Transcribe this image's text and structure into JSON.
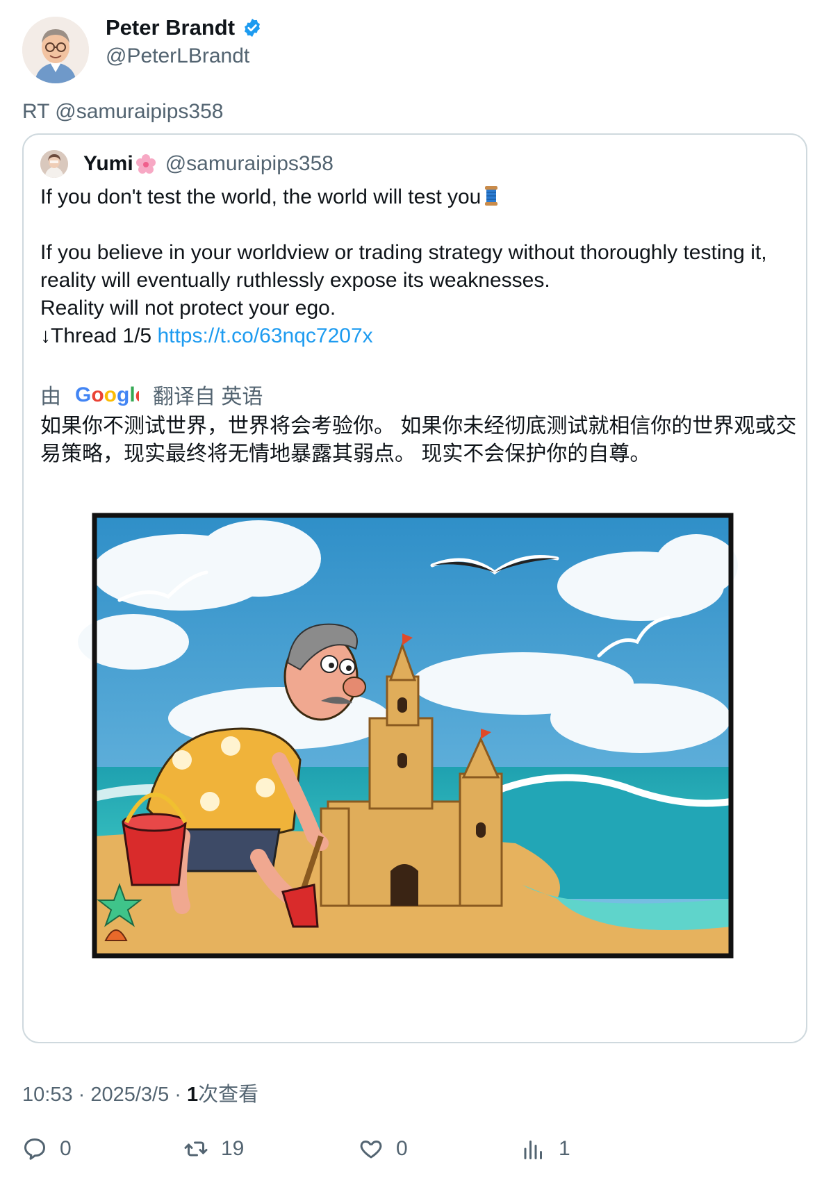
{
  "author": {
    "display_name": "Peter Brandt",
    "handle": "@PeterLBrandt",
    "verified_icon": "verified-badge-icon",
    "accent": "#1d9bf0"
  },
  "retweet_line": "RT @samuraipips358",
  "quoted": {
    "display_name": "Yumi",
    "name_emoji": "cherry-blossom-icon",
    "handle": "@samuraipips358",
    "line1": "If you don't test the world, the world will test you",
    "line1_emoji": "spool-of-thread-icon",
    "line2": "If you believe in your worldview or trading strategy without thoroughly testing it, reality will eventually ruthlessly expose its weaknesses.",
    "line3": "Reality will not protect your ego.",
    "line4_prefix": "↓Thread 1/5 ",
    "link": "https://t.co/63nqc7207x",
    "translate_by": "由",
    "translate_brand": "Google",
    "translate_from": "翻译自 英语",
    "translated_text": "如果你不测试世界，世界将会考验你。 如果你未经彻底测试就相信你的世界观或交易策略，现实最终将无情地暴露其弱点。 现实不会保护你的自尊。",
    "image": "cartoon-man-building-sandcastle-beach-illustration"
  },
  "meta": {
    "time": "10:53 · 2025/3/5 · ",
    "views_count": "1",
    "views_label": "次查看"
  },
  "actions": {
    "replies": "0",
    "retweets": "19",
    "likes": "0",
    "views": "1"
  }
}
